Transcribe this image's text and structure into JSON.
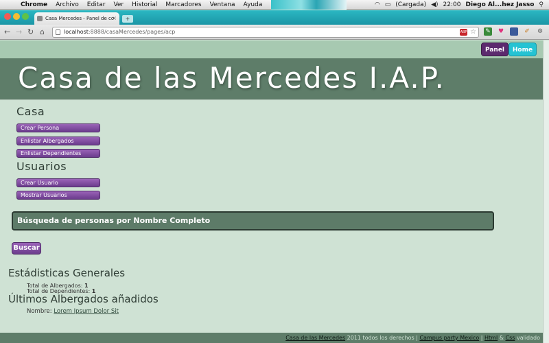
{
  "menubar": {
    "apple": "",
    "menus": [
      "Chrome",
      "Archivo",
      "Editar",
      "Ver",
      "Historial",
      "Marcadores",
      "Ventana",
      "Ayuda"
    ],
    "battery": "(Cargada)",
    "clock": "22:00",
    "user": "Diego Al...hez Jasso"
  },
  "browser": {
    "tab_title": "Casa Mercedes - Panel de co",
    "url_host": "localhost",
    "url_rest": ":8888/casaMercedes/pages/acp",
    "abp": "ABP"
  },
  "nav": {
    "panel": "Panel",
    "home": "Home"
  },
  "site_title": "Casa de las Mercedes I.A.P.",
  "casa": {
    "heading": "Casa",
    "buttons": [
      "Crear Persona",
      "Enlistar Albergados",
      "Enlistar Dependientes"
    ]
  },
  "usuarios": {
    "heading": "Usuarios",
    "buttons": [
      "Crear Usuario",
      "Mostrar Usuarios"
    ]
  },
  "search": {
    "title": "Búsqueda de personas por Nombre Completo",
    "button": "Buscar"
  },
  "stats": {
    "heading": "Estádisticas Generales",
    "albergados_label": "Total de Albergados:",
    "albergados_value": "1",
    "dependientes_label": "Total de Dependientes:",
    "dependientes_value": "1"
  },
  "latest": {
    "heading": "Últimos Albergados añadidos",
    "name_label": "Nombre:",
    "name_value": "Lorem Ipsum Dolor Sit"
  },
  "footer": {
    "site": "Casa de las Mercedes",
    "rights": " 2011 todos los derechos | ",
    "campus": "Campus party Mexico",
    "sep": " | ",
    "html": "Html",
    "amp": " & ",
    "css": "Css",
    "valid": " validado"
  }
}
